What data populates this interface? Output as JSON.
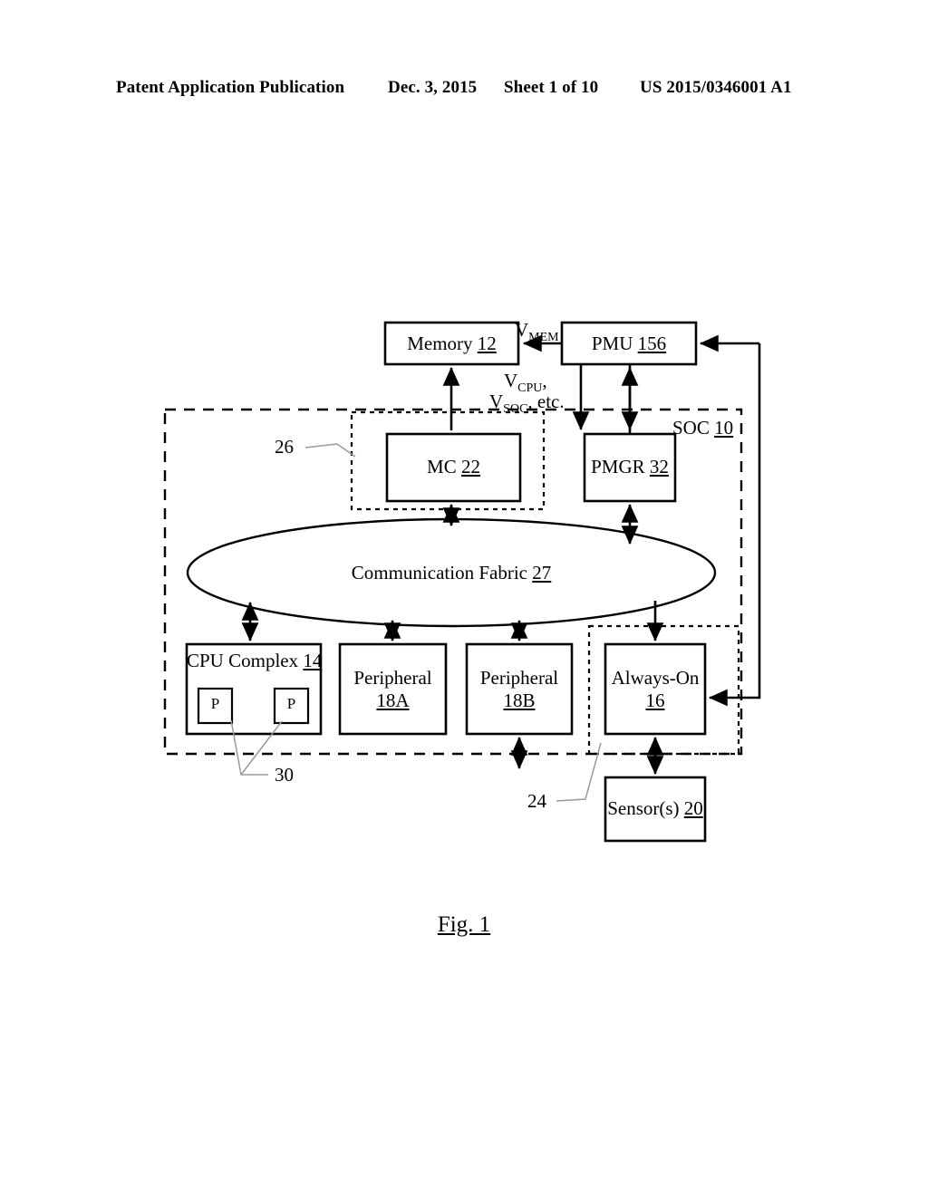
{
  "header": {
    "publication": "Patent Application Publication",
    "date": "Dec. 3, 2015",
    "sheet": "Sheet 1 of 10",
    "patent_number": "US 2015/0346001 A1"
  },
  "figure": {
    "caption": "Fig. 1",
    "blocks": {
      "memory": {
        "name": "Memory",
        "ref": "12"
      },
      "pmu": {
        "name": "PMU",
        "ref": "156"
      },
      "mc": {
        "name": "MC",
        "ref": "22"
      },
      "pmgr": {
        "name": "PMGR",
        "ref": "32"
      },
      "fabric": {
        "name": "Communication Fabric",
        "ref": "27"
      },
      "cpu": {
        "name": "CPU Complex",
        "ref": "14"
      },
      "proc_a": {
        "name": "P"
      },
      "proc_b": {
        "name": "P"
      },
      "periph_a": {
        "name": "Peripheral",
        "ref": "18A"
      },
      "periph_b": {
        "name": "Peripheral",
        "ref": "18B"
      },
      "always_on": {
        "name": "Always-On",
        "ref": "16"
      },
      "sensors": {
        "name": "Sensor(s)",
        "ref": "20"
      },
      "soc": {
        "name": "SOC",
        "ref": "10"
      }
    },
    "reference_numerals": {
      "memory_subsystem": "26",
      "processors": "30",
      "always_on_domain": "24"
    },
    "supply_labels": {
      "vmem_v": "V",
      "vmem_sub": "MEM",
      "vcpu_v": "V",
      "vcpu_sub": "CPU",
      "vcpu_tail": ",",
      "vsoc_v": "V",
      "vsoc_sub": "SOC",
      "vsoc_tail": ", etc."
    }
  },
  "colors": {
    "ink": "#000000",
    "paper": "#ffffff",
    "leader": "#9a9a9a"
  }
}
